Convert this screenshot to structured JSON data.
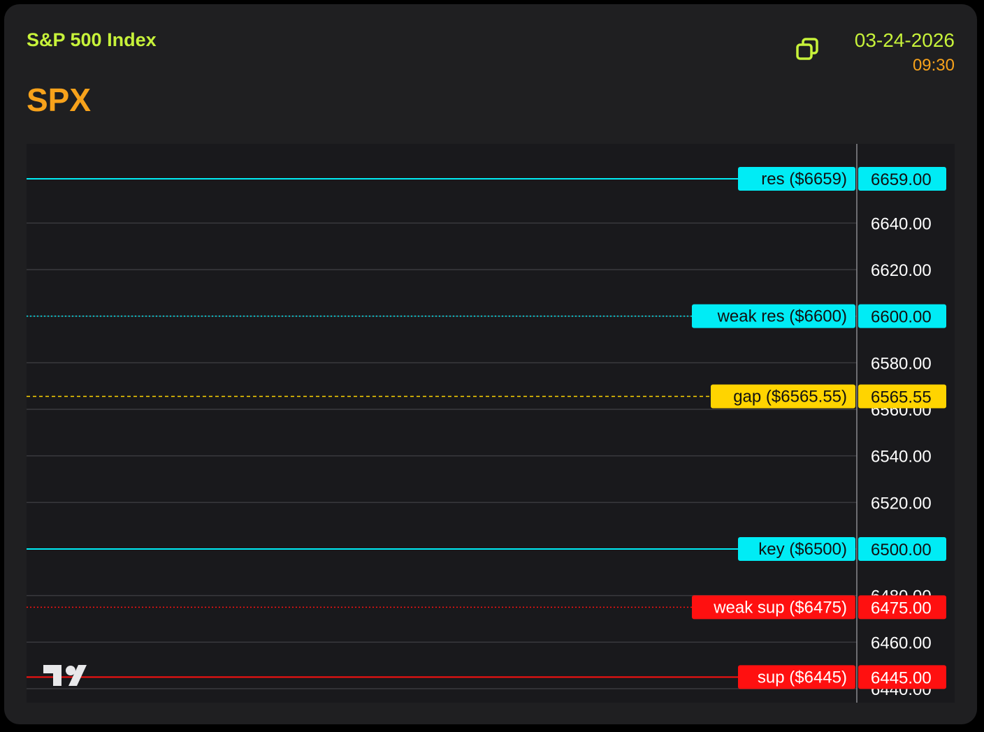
{
  "header": {
    "index_name": "S&P 500 Index",
    "ticker": "SPX",
    "date": "03-24-2026",
    "time": "09:30",
    "copy_icon": "copy-icon"
  },
  "colors": {
    "lime": "#c7f23a",
    "orange": "#f7a21b",
    "cyan": "#00ecf5",
    "yellow": "#ffd400",
    "red": "#ff1010",
    "grid": "#3a3a3e",
    "axis_text": "#ffffff"
  },
  "chart_data": {
    "type": "line",
    "ylim": [
      6434,
      6674
    ],
    "y_ticks": [
      "6640.00",
      "6620.00",
      "6600.00",
      "6580.00",
      "6560.00",
      "6540.00",
      "6520.00",
      "6480.00",
      "6460.00",
      "6440.00"
    ],
    "y_tick_values": [
      6640,
      6620,
      6600,
      6580,
      6560,
      6540,
      6520,
      6480,
      6460,
      6440
    ],
    "hidden_grid_values": [
      6500
    ],
    "grid": true,
    "watermark": "tradingview-logo",
    "levels": [
      {
        "name": "res ($6659)",
        "value": 6659,
        "price_label": "6659.00",
        "color": "#00ecf5",
        "style": "solid",
        "width": 2
      },
      {
        "name": "weak res ($6600)",
        "value": 6600,
        "price_label": "6600.00",
        "color": "#00ecf5",
        "style": "dotted",
        "width": 1.5
      },
      {
        "name": "gap ($6565.55)",
        "value": 6565.55,
        "price_label": "6565.55",
        "color": "#ffd400",
        "style": "dashed",
        "width": 1.5
      },
      {
        "name": "key ($6500)",
        "value": 6500,
        "price_label": "6500.00",
        "color": "#00ecf5",
        "style": "solid",
        "width": 2
      },
      {
        "name": "weak sup ($6475)",
        "value": 6475,
        "price_label": "6475.00",
        "color": "#ff1010",
        "style": "dotted",
        "width": 1.5
      },
      {
        "name": "sup ($6445)",
        "value": 6445,
        "price_label": "6445.00",
        "color": "#ff1010",
        "style": "solid",
        "width": 2
      }
    ]
  }
}
